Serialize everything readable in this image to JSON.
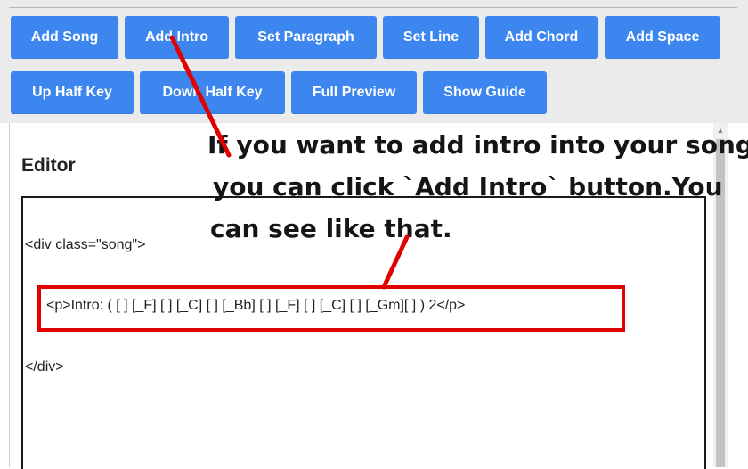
{
  "toolbar": {
    "row1": [
      "Add Song",
      "Add Intro",
      "Set Paragraph",
      "Set Line",
      "Add Chord",
      "Add Space"
    ],
    "row2": [
      "Up Half Key",
      "Down Half Key",
      "Full Preview",
      "Show Guide"
    ]
  },
  "editor": {
    "label": "Editor",
    "lines": [
      "<div class=\"song\">",
      "<p>Intro: ( [ ] [_F] [ ] [_C] [ ] [_Bb] [ ] [_F] [ ] [_C] [ ] [_Gm][ ] ) 2</p>",
      "</div>"
    ]
  },
  "annotation": {
    "line1": "If you want to add intro into your song,",
    "line2": "you  can click `Add Intro` button.You",
    "line3": "can see like that."
  },
  "colors": {
    "button": "#3d86f0",
    "highlight": "#e00000",
    "arrow": "#e00000"
  }
}
